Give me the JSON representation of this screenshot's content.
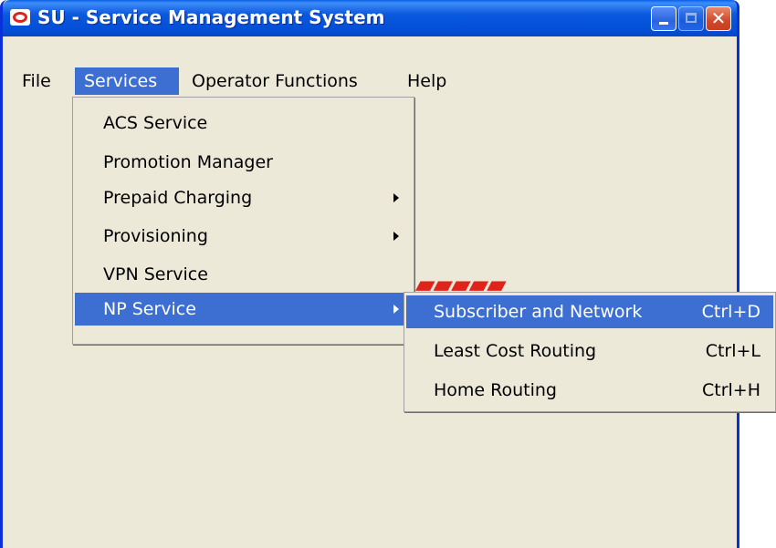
{
  "window": {
    "title": "SU - Service Management System",
    "close_glyph": "✕"
  },
  "menubar": {
    "file": "File",
    "services": "Services",
    "operator_functions": "Operator Functions",
    "help": "Help"
  },
  "services_menu": {
    "items": [
      {
        "label": "ACS Service"
      },
      {
        "label": "Promotion Manager"
      },
      {
        "label": "Prepaid Charging"
      },
      {
        "label": "Provisioning"
      },
      {
        "label": "VPN Service"
      },
      {
        "label": "NP Service"
      }
    ]
  },
  "np_submenu": {
    "items": [
      {
        "label": "Subscriber and Network",
        "shortcut": "Ctrl+D"
      },
      {
        "label": "Least Cost Routing",
        "shortcut": "Ctrl+L"
      },
      {
        "label": "Home Routing",
        "shortcut": "Ctrl+H"
      }
    ]
  },
  "colors": {
    "titlebar": "#0a58dc",
    "menu_highlight": "#3c6fd1",
    "window_bg": "#ece9d8",
    "logo_red": "#e0241b"
  },
  "icons": [
    "app-logo-icon",
    "minimize-icon",
    "maximize-icon",
    "close-icon",
    "submenu-arrow-icon"
  ]
}
